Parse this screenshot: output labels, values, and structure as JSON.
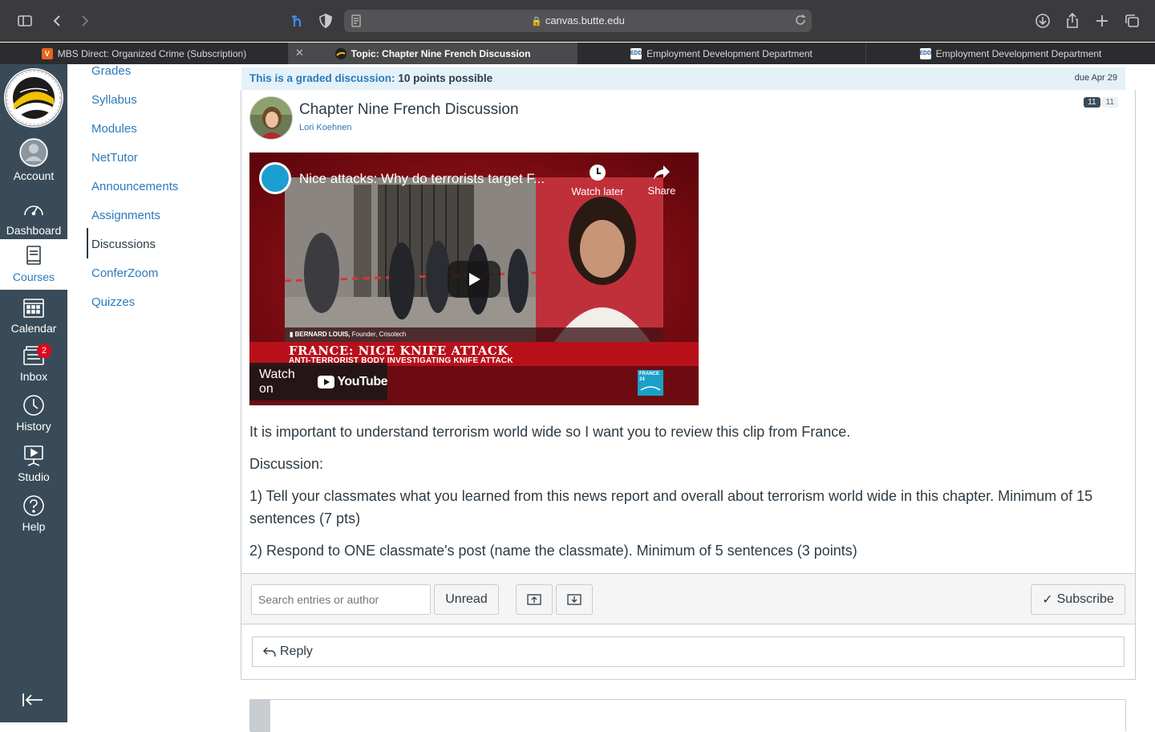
{
  "browser": {
    "url": "canvas.butte.edu",
    "tabs": [
      {
        "label": "MBS Direct: Organized Crime (Subscription)",
        "favicon": "V"
      },
      {
        "label": "Topic: Chapter Nine French Discussion",
        "favicon": "butte-logo"
      },
      {
        "label": "Employment Development Department",
        "favicon": "EDD"
      },
      {
        "label": "Employment Development Department",
        "favicon": "EDD"
      }
    ]
  },
  "global_nav": {
    "items": [
      {
        "label": "Account",
        "icon": "account-icon"
      },
      {
        "label": "Dashboard",
        "icon": "dashboard-icon"
      },
      {
        "label": "Courses",
        "icon": "courses-icon",
        "active": true
      },
      {
        "label": "Calendar",
        "icon": "calendar-icon"
      },
      {
        "label": "Inbox",
        "icon": "inbox-icon",
        "badge": "2"
      },
      {
        "label": "History",
        "icon": "history-icon"
      },
      {
        "label": "Studio",
        "icon": "studio-icon"
      },
      {
        "label": "Help",
        "icon": "help-icon"
      }
    ]
  },
  "course_nav": {
    "items": [
      "Grades",
      "Syllabus",
      "Modules",
      "NetTutor",
      "Announcements",
      "Assignments",
      "Discussions",
      "ConferZoom",
      "Quizzes"
    ],
    "active": "Discussions"
  },
  "discussion": {
    "graded_label": "This is a graded discussion:",
    "points": "10 points possible",
    "due": "due Apr 29",
    "title": "Chapter Nine French Discussion",
    "author": "Lori Koehnen",
    "unread_count": "11",
    "total_count": "11",
    "video": {
      "title": "Nice attacks: Why do terrorists target F...",
      "watch_later": "Watch later",
      "share": "Share",
      "lower_third_name": "BERNARD LOUIS,",
      "lower_third_role": "Founder, Crisotech",
      "headline": "FRANCE: NICE KNIFE ATTACK",
      "subheadline": "ANTI-TERRORIST BODY INVESTIGATING KNIFE ATTACK",
      "watch_on": "Watch on",
      "youtube": "YouTube",
      "channel_logo": "FRANCE 24"
    },
    "paragraphs": [
      "It is important to understand terrorism world wide so I want you to review this clip from France.",
      "Discussion:",
      "1) Tell your classmates what you learned from this news report and overall about terrorism world wide in this chapter.  Minimum of 15 sentences (7 pts)",
      "2) Respond to ONE classmate's post (name the classmate).  Minimum of 5 sentences (3 points)"
    ]
  },
  "actions": {
    "search_placeholder": "Search entries or author",
    "unread": "Unread",
    "subscribe": "Subscribe",
    "reply": "Reply"
  }
}
